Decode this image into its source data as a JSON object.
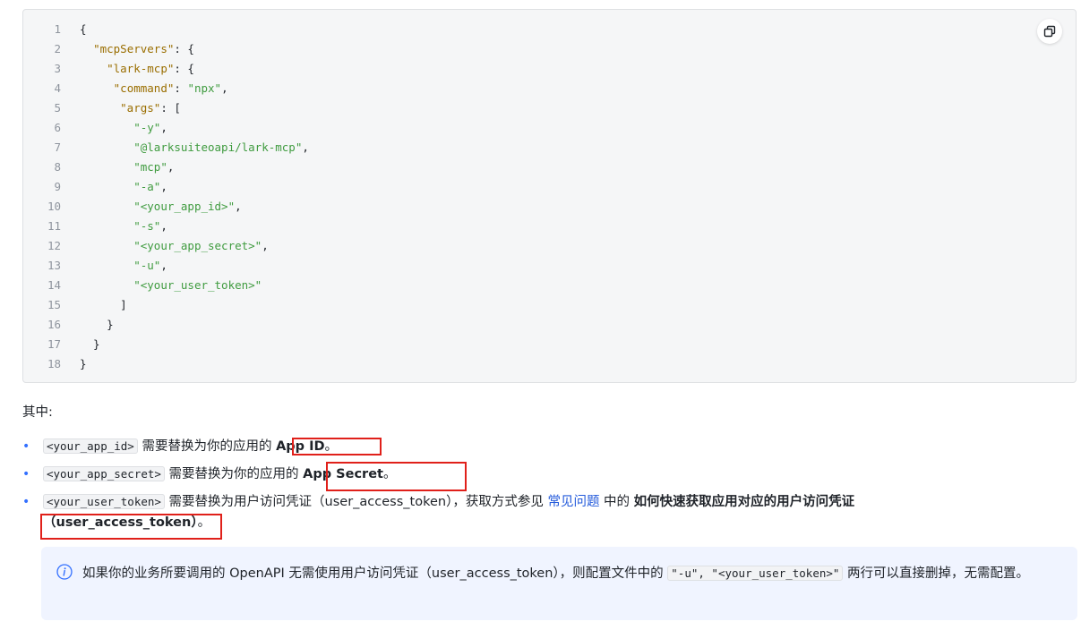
{
  "code_block": {
    "copy_icon": "copy-icon",
    "lines": [
      {
        "n": "1",
        "tokens": [
          {
            "t": "p",
            "v": "{"
          }
        ]
      },
      {
        "n": "2",
        "tokens": [
          {
            "t": "p",
            "v": "  "
          },
          {
            "t": "key",
            "v": "\"mcpServers\""
          },
          {
            "t": "p",
            "v": ": {"
          }
        ]
      },
      {
        "n": "3",
        "tokens": [
          {
            "t": "p",
            "v": "    "
          },
          {
            "t": "key",
            "v": "\"lark-mcp\""
          },
          {
            "t": "p",
            "v": ": {"
          }
        ]
      },
      {
        "n": "4",
        "tokens": [
          {
            "t": "p",
            "v": "     "
          },
          {
            "t": "key",
            "v": "\"command\""
          },
          {
            "t": "p",
            "v": ": "
          },
          {
            "t": "str",
            "v": "\"npx\""
          },
          {
            "t": "p",
            "v": ","
          }
        ]
      },
      {
        "n": "5",
        "tokens": [
          {
            "t": "p",
            "v": "      "
          },
          {
            "t": "key",
            "v": "\"args\""
          },
          {
            "t": "p",
            "v": ": ["
          }
        ]
      },
      {
        "n": "6",
        "tokens": [
          {
            "t": "p",
            "v": "        "
          },
          {
            "t": "str",
            "v": "\"-y\""
          },
          {
            "t": "p",
            "v": ","
          }
        ]
      },
      {
        "n": "7",
        "tokens": [
          {
            "t": "p",
            "v": "        "
          },
          {
            "t": "str",
            "v": "\"@larksuiteoapi/lark-mcp\""
          },
          {
            "t": "p",
            "v": ","
          }
        ]
      },
      {
        "n": "8",
        "tokens": [
          {
            "t": "p",
            "v": "        "
          },
          {
            "t": "str",
            "v": "\"mcp\""
          },
          {
            "t": "p",
            "v": ","
          }
        ]
      },
      {
        "n": "9",
        "tokens": [
          {
            "t": "p",
            "v": "        "
          },
          {
            "t": "str",
            "v": "\"-a\""
          },
          {
            "t": "p",
            "v": ","
          }
        ]
      },
      {
        "n": "10",
        "tokens": [
          {
            "t": "p",
            "v": "        "
          },
          {
            "t": "str",
            "v": "\"<your_app_id>\""
          },
          {
            "t": "p",
            "v": ","
          }
        ]
      },
      {
        "n": "11",
        "tokens": [
          {
            "t": "p",
            "v": "        "
          },
          {
            "t": "str",
            "v": "\"-s\""
          },
          {
            "t": "p",
            "v": ","
          }
        ]
      },
      {
        "n": "12",
        "tokens": [
          {
            "t": "p",
            "v": "        "
          },
          {
            "t": "str",
            "v": "\"<your_app_secret>\""
          },
          {
            "t": "p",
            "v": ","
          }
        ]
      },
      {
        "n": "13",
        "tokens": [
          {
            "t": "p",
            "v": "        "
          },
          {
            "t": "str",
            "v": "\"-u\""
          },
          {
            "t": "p",
            "v": ","
          }
        ]
      },
      {
        "n": "14",
        "tokens": [
          {
            "t": "p",
            "v": "        "
          },
          {
            "t": "str",
            "v": "\"<your_user_token>\""
          }
        ]
      },
      {
        "n": "15",
        "tokens": [
          {
            "t": "p",
            "v": "      ]"
          }
        ]
      },
      {
        "n": "16",
        "tokens": [
          {
            "t": "p",
            "v": "    }"
          }
        ]
      },
      {
        "n": "17",
        "tokens": [
          {
            "t": "p",
            "v": "  }"
          }
        ]
      },
      {
        "n": "18",
        "tokens": [
          {
            "t": "p",
            "v": "}"
          }
        ]
      }
    ]
  },
  "intro": "其中:",
  "bullet_symbol": "•",
  "items": [
    {
      "code": "<your_app_id>",
      "text": "需要替换为你的应用的",
      "bold": "App ID",
      "end": "。"
    },
    {
      "code": "<your_app_secret>",
      "text": "需要替换为你的应用的",
      "bold": "App Secret",
      "end": "。"
    },
    {
      "code": "<your_user_token>",
      "text": " 需要替换为用户访问凭证（user_access_token），获取方式参见 ",
      "link": "常见问题",
      "text2": " 中的 ",
      "bold": "如何快速获取应用对应的用户访问凭证",
      "bold2": "（user_access_token）",
      "end": "。"
    }
  ],
  "callout": {
    "icon": "info-icon",
    "text_before": "如果你的业务所要调用的 OpenAPI 无需使用用户访问凭证（user_access_token），则配置文件中的 ",
    "code": "\"-u\", \"<your_user_token>\"",
    "text_after": " 两行可以直接删掉，无需配置。"
  },
  "colors": {
    "highlight_box": "#e0201a",
    "json_key": "#9a6e00",
    "json_string": "#3f9b3f",
    "link": "#245bdb",
    "bullet": "#3370ff",
    "callout_bg": "#f0f4ff"
  }
}
